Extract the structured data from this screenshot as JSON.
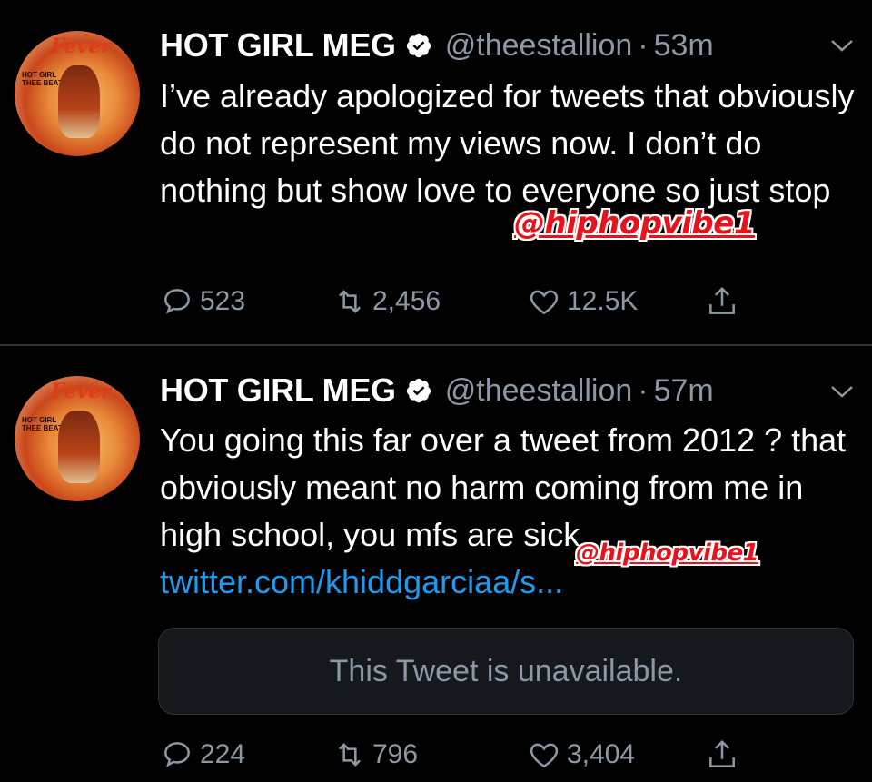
{
  "colors": {
    "background": "#000000",
    "text": "#ffffff",
    "muted": "#8b98a5",
    "link": "#1d9bf0",
    "watermark": "#e8121c"
  },
  "tweets": [
    {
      "name": "HOT GIRL MEG",
      "handle": "@theestallion",
      "separator": "·",
      "time": "53m",
      "text": "I’ve already apologized for tweets that obviously do not represent my views now. I don’t do nothing but show love to everyone so just stop",
      "link": "",
      "watermark": "@hiphopvibe1",
      "replies": "523",
      "retweets": "2,456",
      "likes": "12.5K",
      "avatar_title": "Fever",
      "avatar_sub": "HOT GIRL\nTHEE BEAT"
    },
    {
      "name": "HOT GIRL MEG",
      "handle": "@theestallion",
      "separator": "·",
      "time": "57m",
      "text": "You going this far over a tweet from 2012 ? that obviously meant no harm coming from me in high school,  you mfs are sick",
      "link": "twitter.com/khiddgarciaa/s...",
      "watermark": "@hiphopvibe1",
      "quote": "This Tweet is unavailable.",
      "replies": "224",
      "retweets": "796",
      "likes": "3,404",
      "avatar_title": "Fever",
      "avatar_sub": "HOT GIRL\nTHEE BEAT"
    }
  ],
  "icons": [
    "verified-badge-icon",
    "chevron-down-icon",
    "reply-icon",
    "retweet-icon",
    "like-icon",
    "share-icon"
  ]
}
